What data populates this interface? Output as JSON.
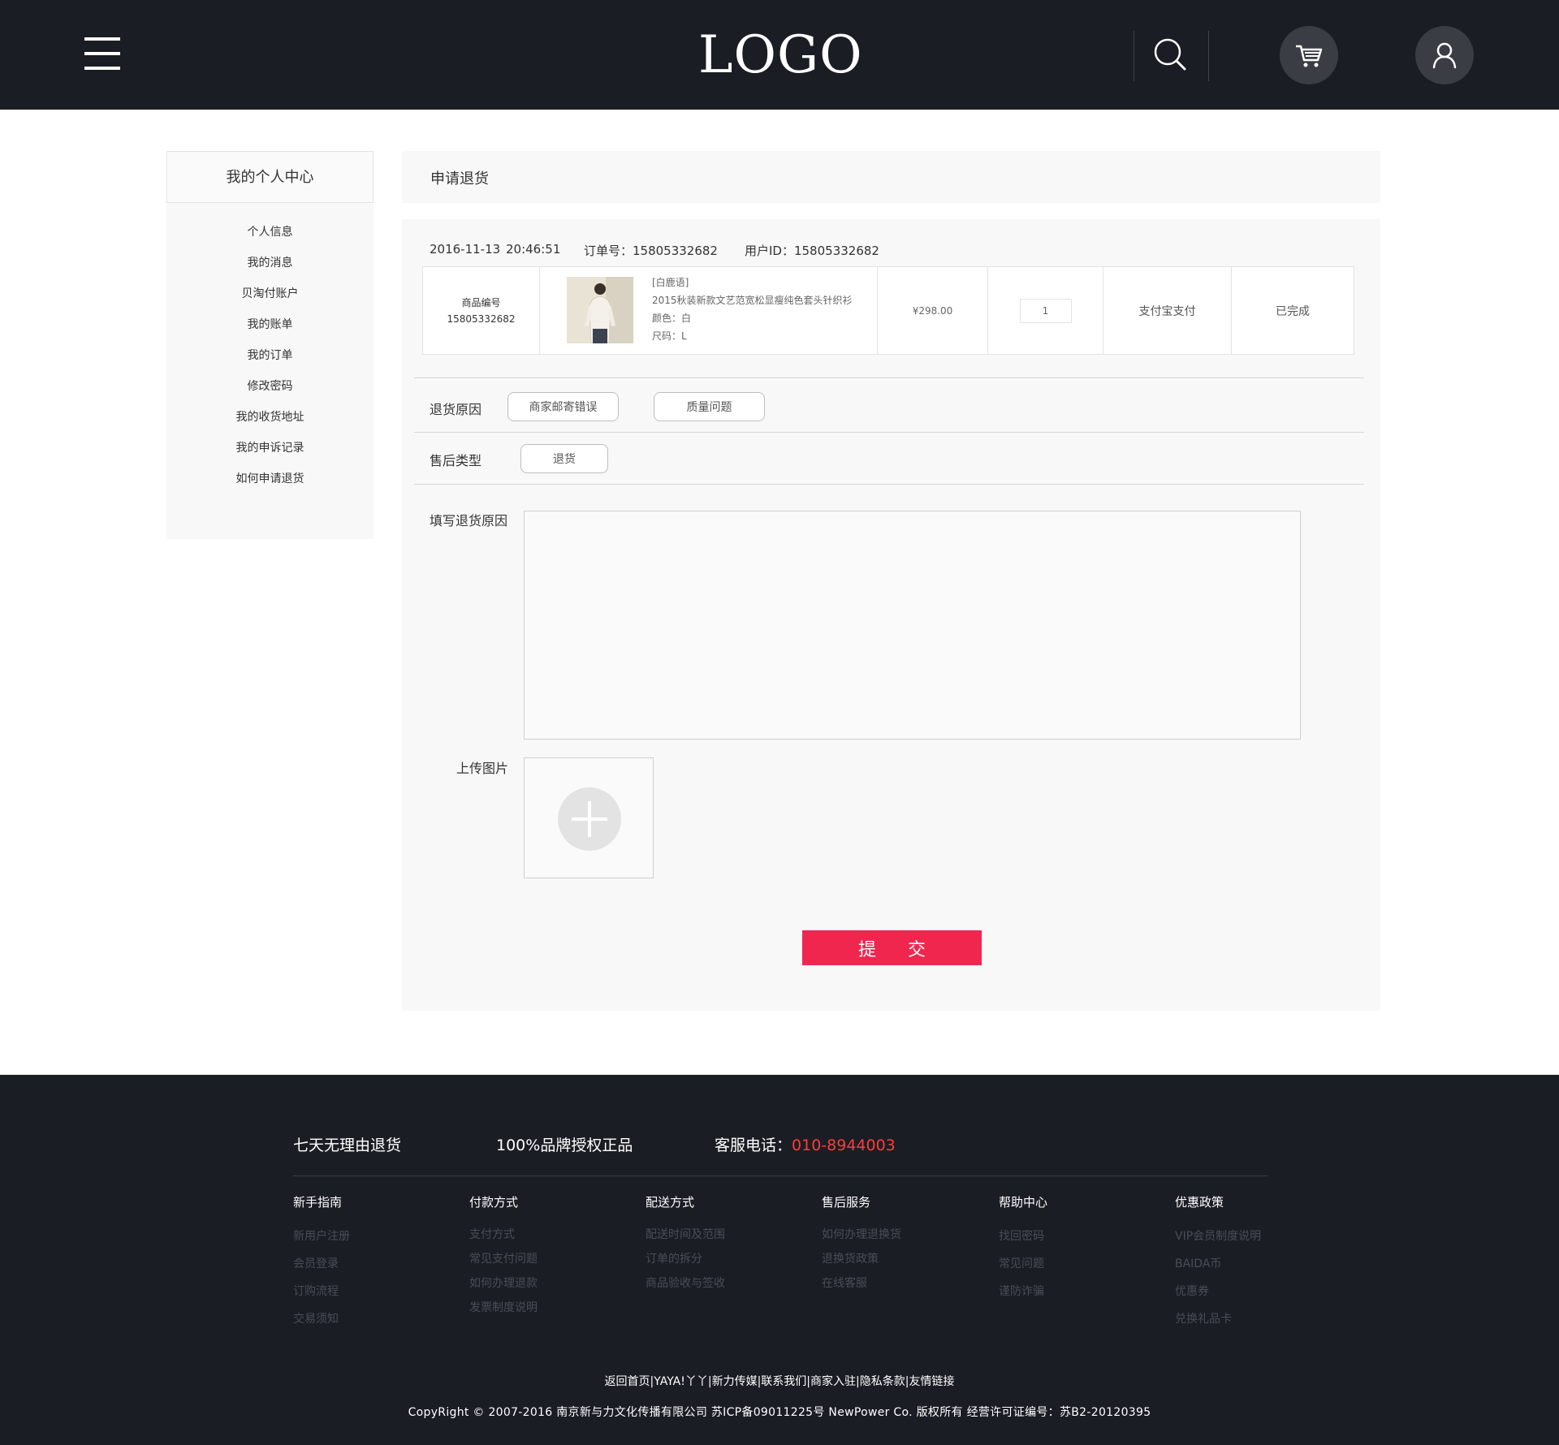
{
  "header": {
    "logo": "LOGO"
  },
  "sidebar": {
    "title": "我的个人中心",
    "items": [
      {
        "label": "个人信息"
      },
      {
        "label": "我的消息"
      },
      {
        "label": "贝淘付账户"
      },
      {
        "label": "我的账单"
      },
      {
        "label": "我的订单"
      },
      {
        "label": "修改密码"
      },
      {
        "label": "我的收货地址"
      },
      {
        "label": "我的申诉记录"
      },
      {
        "label": "如何申请退货"
      }
    ]
  },
  "main": {
    "title": "申请退货",
    "order": {
      "date": "2016-11-13",
      "time": "20:46:51",
      "order_no_label": "订单号：15805332682",
      "user_id_label": "用户ID：15805332682",
      "sku_label": "商品编号",
      "sku_value": "15805332682",
      "brand": "[白鹿语]",
      "product_name": "2015秋装新款文艺范宽松显瘦纯色套头针织衫",
      "color": "颜色：白",
      "size": "尺码：L",
      "price": "¥298.00",
      "quantity": "1",
      "payment": "支付宝支付",
      "status": "已完成"
    },
    "return_reason": {
      "label": "退货原因",
      "options": [
        "商家邮寄错误",
        "质量问题"
      ]
    },
    "service_type": {
      "label": "售后类型",
      "option": "退货"
    },
    "reason_text": {
      "label": "填写退货原因",
      "value": ""
    },
    "upload": {
      "label": "上传图片"
    },
    "submit_label": "提 交",
    "accent_color": "#f0264f"
  },
  "footer": {
    "promises": {
      "returns": "七天无理由退货",
      "authentic": "100%品牌授权正品",
      "phone_label": "客服电话：",
      "phone": "010-8944003"
    },
    "columns": [
      {
        "title": "新手指南",
        "links": [
          "新用户注册",
          "会员登录",
          "订购流程",
          "交易须知"
        ]
      },
      {
        "title": "付款方式",
        "links": [
          "支付方式",
          "常见支付问题",
          "如何办理退款",
          "发票制度说明"
        ]
      },
      {
        "title": "配送方式",
        "links": [
          "配送时间及范围",
          "订单的拆分",
          "商品验收与签收"
        ]
      },
      {
        "title": "售后服务",
        "links": [
          "如何办理退换货",
          "退换货政策",
          "在线客服"
        ]
      },
      {
        "title": "帮助中心",
        "links": [
          "找回密码",
          "常见问题",
          "谨防诈骗"
        ]
      },
      {
        "title": "优惠政策",
        "links": [
          "VIP会员制度说明",
          "BAIDA币",
          "优惠券",
          "兑换礼品卡"
        ]
      }
    ],
    "bottom_links": [
      "返回首页",
      "YAYA!丫丫",
      "新力传媒",
      "联系我们",
      "商家入驻",
      "隐私条款",
      "友情链接"
    ],
    "copyright": "CopyRight © 2007-2016 南京新与力文化传播有限公司 苏ICP备09011225号 NewPower Co. 版权所有 经营许可证编号：苏B2-20120395"
  }
}
